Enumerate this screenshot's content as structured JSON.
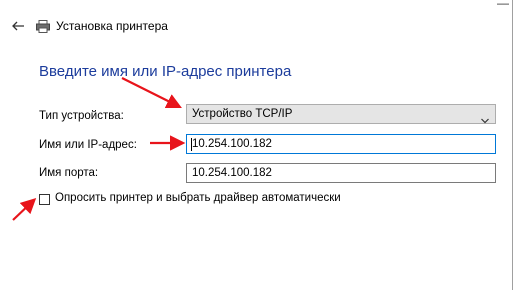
{
  "window": {
    "title": "Установка принтера",
    "close_glyph": "—"
  },
  "heading": "Введите имя или IP-адрес принтера",
  "form": {
    "device_type": {
      "label": "Тип устройства:",
      "selected": "Устройство TCP/IP"
    },
    "ip_address": {
      "label": "Имя или IP-адрес:",
      "value": "10.254.100.182"
    },
    "port_name": {
      "label": "Имя порта:",
      "value": "10.254.100.182"
    },
    "auto_driver": {
      "label": "Опросить принтер и выбрать драйвер автоматически",
      "checked": false
    }
  },
  "icons": {
    "back": "back-arrow-icon",
    "printer": "printer-icon",
    "chevron": "chevron-down-icon",
    "close": "close-icon"
  },
  "annotation_color": "#e8141b"
}
